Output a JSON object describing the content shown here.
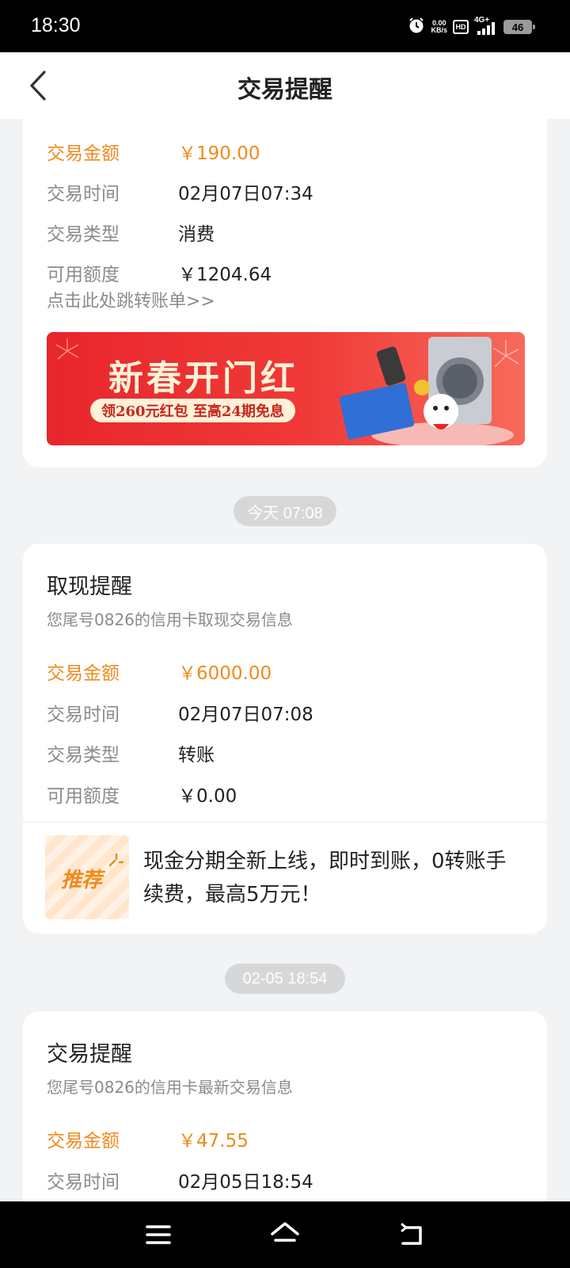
{
  "status_bar": {
    "time": "18:30",
    "net_speed_value": "0.00",
    "net_speed_unit": "KB/s",
    "hd": "HD",
    "signal": "4G+",
    "battery": "46"
  },
  "header": {
    "title": "交易提醒",
    "back_icon": "chevron-left-icon"
  },
  "cards": [
    {
      "rows": [
        {
          "label": "交易金额",
          "value": "￥190.00"
        },
        {
          "label": "交易时间",
          "value": "02月07日07:34"
        },
        {
          "label": "交易类型",
          "value": "消费"
        },
        {
          "label": "可用额度",
          "value": "￥1204.64"
        }
      ],
      "link": "点击此处跳转账单>>",
      "banner": {
        "title": "新春开门红",
        "subtitle": "领260元红包 至高24期免息"
      }
    },
    {
      "time_pill": "今天 07:08",
      "title": "取现提醒",
      "subtitle": "您尾号0826的信用卡取现交易信息",
      "rows": [
        {
          "label": "交易金额",
          "value": "￥6000.00"
        },
        {
          "label": "交易时间",
          "value": "02月07日07:08"
        },
        {
          "label": "交易类型",
          "value": "转账"
        },
        {
          "label": "可用额度",
          "value": "￥0.00"
        }
      ],
      "recommend": {
        "badge": "推荐",
        "text": "现金分期全新上线，即时到账，0转账手续费，最高5万元！"
      }
    },
    {
      "time_pill": "02-05 18:54",
      "title": "交易提醒",
      "subtitle": "您尾号0826的信用卡最新交易信息",
      "rows": [
        {
          "label": "交易金额",
          "value": "￥47.55"
        },
        {
          "label": "交易时间",
          "value": "02月05日18:54"
        }
      ]
    }
  ],
  "nav_bar": {
    "menu_icon": "menu-icon",
    "home_icon": "home-icon",
    "back_icon": "back-icon"
  },
  "colors": {
    "accent": "#f08a1c",
    "background": "#f2f3f5",
    "banner_red": "#e8262c"
  }
}
